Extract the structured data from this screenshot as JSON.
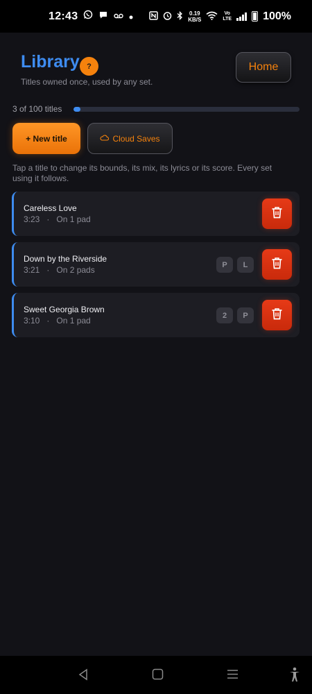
{
  "status_bar": {
    "time": "12:43",
    "speed_value": "0.19",
    "speed_unit": "KB/S",
    "volte_top": "Vo",
    "volte_bottom": "LTE",
    "battery": "100%"
  },
  "header": {
    "title": "Library",
    "help_label": "?",
    "subtitle": "Titles owned once, used by any set.",
    "home_label": "Home"
  },
  "progress": {
    "count_label": "3 of 100 titles",
    "fraction": 0.03
  },
  "actions": {
    "new_title_label": "+ New title",
    "cloud_saves_label": "Cloud Saves"
  },
  "hint": "Tap a title to change its bounds, its mix, its lyrics or its score. Every set using it follows.",
  "titles": [
    {
      "name": "Careless Love",
      "duration": "3:23",
      "pads": "On 1 pad",
      "tags": []
    },
    {
      "name": "Down by the Riverside",
      "duration": "3:21",
      "pads": "On 2 pads",
      "tags": [
        "P",
        "L"
      ]
    },
    {
      "name": "Sweet Georgia Brown",
      "duration": "3:10",
      "pads": "On 1 pad",
      "tags": [
        "2",
        "P"
      ]
    }
  ],
  "colors": {
    "accent_blue": "#3e8cf0",
    "accent_orange": "#f5820d",
    "delete_red": "#e63a17",
    "background": "#121217"
  },
  "icons": {
    "delete": "trash-icon",
    "cloud": "cloud-icon",
    "nav_back": "back-triangle-icon",
    "nav_home": "home-square-icon",
    "nav_recents": "recents-menu-icon",
    "accessibility": "accessibility-icon"
  }
}
